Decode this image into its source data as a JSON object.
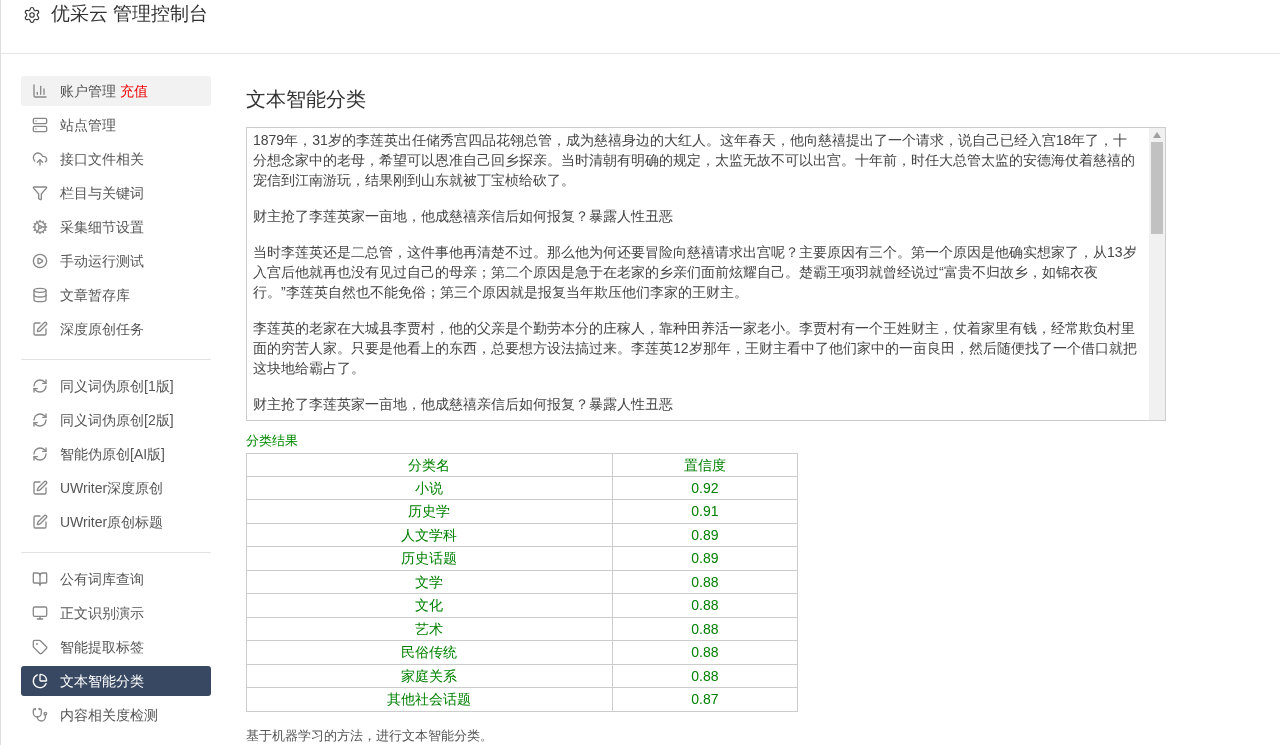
{
  "header": {
    "title": "优采云 管理控制台"
  },
  "sidebar": {
    "groups": [
      {
        "items": [
          {
            "label": "账户管理",
            "badge": "充值",
            "highlighted": true,
            "selected": false
          },
          {
            "label": "站点管理",
            "highlighted": false,
            "selected": false
          },
          {
            "label": "接口文件相关",
            "highlighted": false,
            "selected": false
          },
          {
            "label": "栏目与关键词",
            "highlighted": false,
            "selected": false
          },
          {
            "label": "采集细节设置",
            "highlighted": false,
            "selected": false
          },
          {
            "label": "手动运行测试",
            "highlighted": false,
            "selected": false
          },
          {
            "label": "文章暂存库",
            "highlighted": false,
            "selected": false
          },
          {
            "label": "深度原创任务",
            "highlighted": false,
            "selected": false
          }
        ]
      },
      {
        "items": [
          {
            "label": "同义词伪原创[1版]",
            "highlighted": false,
            "selected": false
          },
          {
            "label": "同义词伪原创[2版]",
            "highlighted": false,
            "selected": false
          },
          {
            "label": "智能伪原创[AI版]",
            "highlighted": false,
            "selected": false
          },
          {
            "label": "UWriter深度原创",
            "highlighted": false,
            "selected": false
          },
          {
            "label": "UWriter原创标题",
            "highlighted": false,
            "selected": false
          }
        ]
      },
      {
        "items": [
          {
            "label": "公有词库查询",
            "highlighted": false,
            "selected": false
          },
          {
            "label": "正文识别演示",
            "highlighted": false,
            "selected": false
          },
          {
            "label": "智能提取标签",
            "highlighted": false,
            "selected": false
          },
          {
            "label": "文本智能分类",
            "highlighted": false,
            "selected": true
          },
          {
            "label": "内容相关度检测",
            "highlighted": false,
            "selected": false
          }
        ]
      }
    ]
  },
  "main": {
    "heading": "文本智能分类",
    "text_input": {
      "value": [
        "1879年，31岁的李莲英出任储秀宫四品花翎总管，成为慈禧身边的大红人。这年春天，他向慈禧提出了一个请求，说自己已经入宫18年了，十分想念家中的老母，希望可以恩准自己回乡探亲。当时清朝有明确的规定，太监无故不可以出宫。十年前，时任大总管太监的安德海仗着慈禧的宠信到江南游玩，结果刚到山东就被丁宝桢给砍了。",
        "财主抢了李莲英家一亩地，他成慈禧亲信后如何报复？暴露人性丑恶",
        "当时李莲英还是二总管，这件事他再清楚不过。那么他为何还要冒险向慈禧请求出宫呢？主要原因有三个。第一个原因是他确实想家了，从13岁入宫后他就再也没有见过自己的母亲；第二个原因是急于在老家的乡亲们面前炫耀自己。楚霸王项羽就曾经说过“富贵不归故乡，如锦衣夜行。”李莲英自然也不能免俗；第三个原因就是报复当年欺压他们李家的王财主。",
        "李莲英的老家在大城县李贾村，他的父亲是个勤劳本分的庄稼人，靠种田养活一家老小。李贾村有一个王姓财主，仗着家里有钱，经常欺负村里面的穷苦人家。只要是他看上的东西，总要想方设法搞过来。李莲英12岁那年，王财主看中了他们家中的一亩良田，然后随便找了一个借口就把这块地给霸占了。",
        "财主抢了李莲英家一亩地，他成慈禧亲信后如何报复？暴露人性丑恶"
      ]
    },
    "result_label": "分类结果",
    "table": {
      "columns": [
        "分类名",
        "置信度"
      ],
      "rows": [
        [
          "小说",
          "0.92"
        ],
        [
          "历史学",
          "0.91"
        ],
        [
          "人文学科",
          "0.89"
        ],
        [
          "历史话题",
          "0.89"
        ],
        [
          "文学",
          "0.88"
        ],
        [
          "文化",
          "0.88"
        ],
        [
          "艺术",
          "0.88"
        ],
        [
          "民俗传统",
          "0.88"
        ],
        [
          "家庭关系",
          "0.88"
        ],
        [
          "其他社会话题",
          "0.87"
        ]
      ]
    },
    "description": "基于机器学习的方法，进行文本智能分类。"
  }
}
